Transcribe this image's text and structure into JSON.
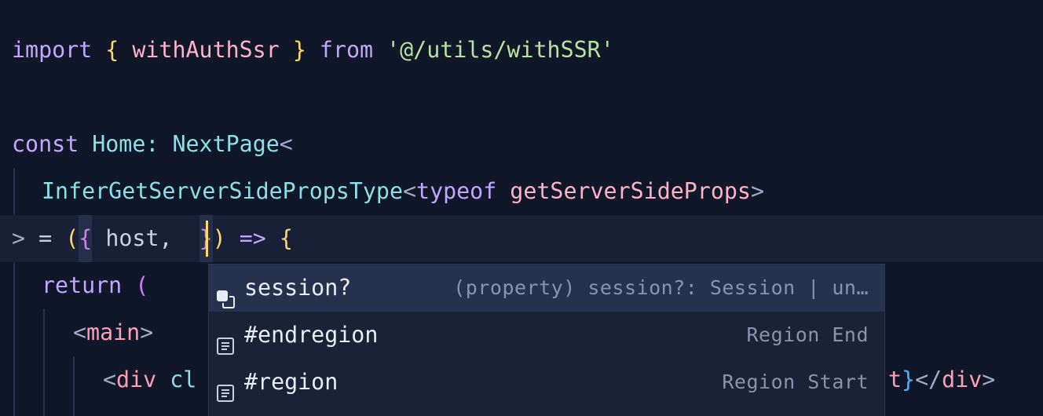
{
  "editor": {
    "line1": {
      "kw_import": "import",
      "brace_open": "{",
      "ident": "withAuthSsr",
      "brace_close": "}",
      "kw_from": "from",
      "module": "'@/utils/withSSR'"
    },
    "line2": {
      "kw_const": "const",
      "name": "Home",
      "colon": ":",
      "type": "NextPage",
      "lt": "<"
    },
    "line3": {
      "type": "InferGetServerSidePropsType",
      "lt": "<",
      "kw_typeof": "typeof",
      "ident": "getServerSideProps",
      "gt": ">"
    },
    "line4": {
      "gt": ">",
      "eq": "=",
      "paren_open": "(",
      "brace_open": "{",
      "param": "host,",
      "brace_close": "}",
      "paren_close": ")",
      "arrow": "=>",
      "body_open": "{"
    },
    "line5": {
      "kw_return": "return",
      "paren": "("
    },
    "line6": {
      "lt": "<",
      "tag": "main",
      "gt": ">"
    },
    "line7": {
      "lt": "<",
      "tag": "div",
      "attr_partial": "cl",
      "tail_t": "t",
      "tail_brace": "}",
      "close_lt": "</",
      "close_tag": "div",
      "close_gt": ">"
    }
  },
  "suggestions": [
    {
      "label": "session?",
      "detail": "(property) session?: Session | un…",
      "icon": "property-icon",
      "selected": true
    },
    {
      "label": "#endregion",
      "detail": "Region End",
      "icon": "snippet-icon",
      "selected": false
    },
    {
      "label": "#region",
      "detail": "Region Start",
      "icon": "snippet-icon",
      "selected": false
    }
  ],
  "colors": {
    "background": "#0f1729",
    "current_line": "#172036",
    "cursor": "#ffd866",
    "keyword": "#c3a6ff",
    "string": "#b9e2a0",
    "type": "#8fdfe8"
  }
}
